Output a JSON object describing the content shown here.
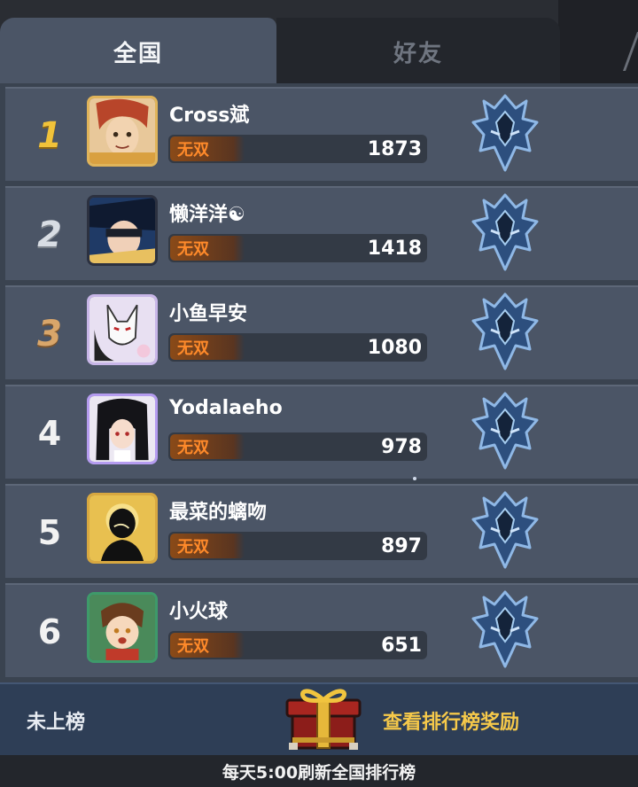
{
  "tabs": [
    {
      "label": "全国",
      "active": true
    },
    {
      "label": "好友",
      "active": false
    }
  ],
  "leaderboard": [
    {
      "rank": "1",
      "name": "Cross斌",
      "tier": "无双",
      "score": "1873",
      "avatar": "red-haired-hero-avatar"
    },
    {
      "rank": "2",
      "name": "懒洋洋☯",
      "tier": "无双",
      "score": "1418",
      "avatar": "masked-hero-avatar"
    },
    {
      "rank": "3",
      "name": "小鱼早安",
      "tier": "无双",
      "score": "1080",
      "avatar": "fox-mask-avatar"
    },
    {
      "rank": "4",
      "name": "Yodalaeho",
      "tier": "无双",
      "score": "978",
      "avatar": "dark-haired-girl-avatar"
    },
    {
      "rank": "5",
      "name": "最菜的螭吻",
      "tier": "无双",
      "score": "897",
      "avatar": "shadow-figure-avatar"
    },
    {
      "rank": "6",
      "name": "小火球",
      "tier": "无双",
      "score": "651",
      "avatar": "brown-haired-kid-avatar"
    }
  ],
  "footer": {
    "my_status": "未上榜",
    "reward_link": "查看排行榜奖励",
    "refresh_note": "每天5:00刷新全国排行榜"
  },
  "colors": {
    "tier_text": "#ff8a2a",
    "reward_link": "#f6c94a",
    "rank1": "#f0c23a"
  },
  "icons": {
    "rank_emblem": "dragon-helmet-emblem-icon",
    "reward": "gift-box-icon"
  }
}
